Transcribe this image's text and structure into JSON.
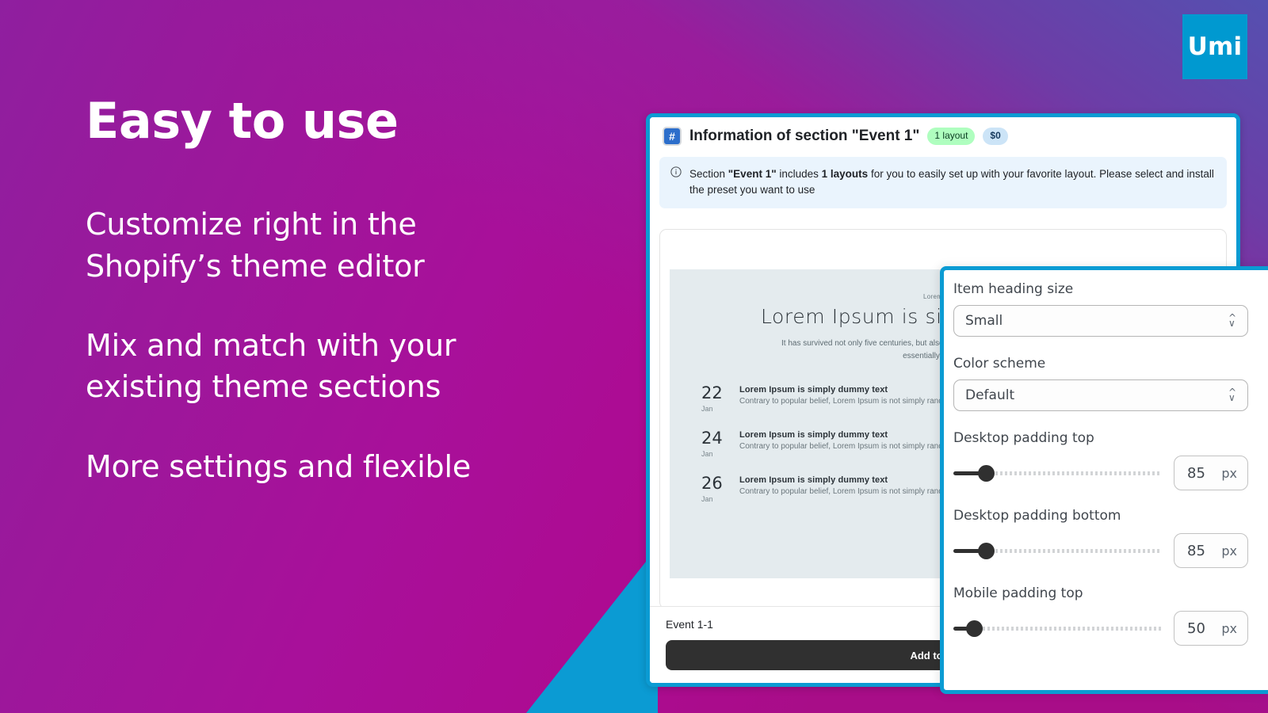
{
  "brand": {
    "logo_text": "Umi",
    "logo_bg": "#0099d0"
  },
  "left_panel": {
    "headline": "Easy to use",
    "bullets": [
      "Customize right in the\nShopify’s theme editor",
      "Mix and match with your\nexisting theme sections",
      "More settings and flexible"
    ],
    "bullet1_line1": "Customize right in the",
    "bullet1_line2": "Shopify’s theme editor",
    "bullet2_line1": "Mix and match with your",
    "bullet2_line2": "existing theme sections",
    "bullet3_line1": "More settings and flexible"
  },
  "card": {
    "icon": "hash-icon",
    "icon_glyph": "#",
    "title": "Information of section \"Event 1\"",
    "badges": [
      {
        "label": "1 layout",
        "type": "layout",
        "color": "#affebf"
      },
      {
        "label": "$0",
        "type": "price",
        "color": "#cce4f7"
      }
    ],
    "info_banner": {
      "icon": "info-circle-icon",
      "icon_glyph": "ⓘ",
      "text_part1": "Section ",
      "text_bold1": "\"Event 1\"",
      "text_part2": " includes ",
      "text_bold2": "1 layouts",
      "text_part3": " for you to easily set up with your favorite layout. Please select and install the preset you want to use"
    },
    "footer": {
      "label": "Event 1-1",
      "button_label": "Add to theme"
    }
  },
  "preview": {
    "eyebrow": "Lorem Ipsum",
    "heading": "Lorem Ipsum is simply dummy text",
    "subtext": "It has survived not only five centuries, but also the leap into electronic typesetting, remaining essentially unchanged.",
    "events": [
      {
        "day": "22",
        "month": "Jan",
        "title": "Lorem Ipsum is simply dummy text",
        "desc": "Contrary to popular belief, Lorem Ipsum is not simply random text."
      },
      {
        "day": "24",
        "month": "Jan",
        "title": "Lorem Ipsum is simply dummy text",
        "desc": "Contrary to popular belief, Lorem Ipsum is not simply random text."
      },
      {
        "day": "26",
        "month": "Jan",
        "title": "Lorem Ipsum is simply dummy text",
        "desc": "Contrary to popular belief, Lorem Ipsum is not simply random text."
      }
    ]
  },
  "settings": {
    "item_heading_size": {
      "label": "Item heading size",
      "value": "Small"
    },
    "color_scheme": {
      "label": "Color scheme",
      "value": "Default"
    },
    "desktop_padding_top": {
      "label": "Desktop padding top",
      "value": "85",
      "unit": "px",
      "percent": 18
    },
    "desktop_padding_bottom": {
      "label": "Desktop padding bottom",
      "value": "85",
      "unit": "px",
      "percent": 18
    },
    "mobile_padding_top": {
      "label": "Mobile padding top",
      "value": "50",
      "unit": "px",
      "percent": 12
    }
  }
}
